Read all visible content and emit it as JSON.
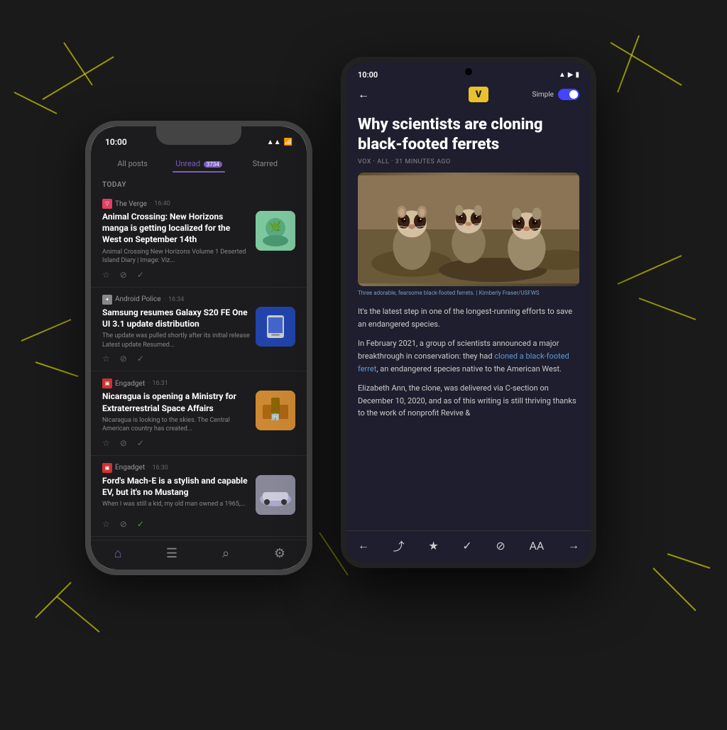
{
  "background": {
    "color": "#1a1a1a"
  },
  "iphone": {
    "status_time": "10:00",
    "tabs": [
      {
        "label": "All posts",
        "active": false
      },
      {
        "label": "Unread",
        "active": true,
        "badge": "3734"
      },
      {
        "label": "Starred",
        "active": false
      }
    ],
    "section_label": "TODAY",
    "feed_items": [
      {
        "source_icon": "▽",
        "source_name": "The Verge",
        "time": "16:40",
        "title": "Animal Crossing: New Horizons manga is getting localized for the West on September 14th",
        "excerpt": "Animal Crossing New Horizons Volume 1 Deserted Island Diary | Image: Viz...",
        "thumb_class": "thumb-ac",
        "has_thumb": true
      },
      {
        "source_icon": "✦",
        "source_name": "Android Police",
        "time": "16:34",
        "title": "Samsung resumes Galaxy S20 FE One UI 3.1 update distribution",
        "excerpt": "The update was pulled shortly after its initial release      Latest update Resumed...",
        "thumb_class": "thumb-samsung",
        "has_thumb": true
      },
      {
        "source_icon": "▣",
        "source_name": "Engadget",
        "time": "16:31",
        "title": "Nicaragua is opening a Ministry for Extraterrestrial Space Affairs",
        "excerpt": "Nicaragua is looking to the skies. The Central American country has created...",
        "thumb_class": "thumb-nicaragua",
        "has_thumb": true
      },
      {
        "source_icon": "▣",
        "source_name": "Engadget",
        "time": "16:30",
        "title": "Ford's Mach-E is a stylish and capable EV, but it's no Mustang",
        "excerpt": "When I was still a kid, my old man owned a 1965,...",
        "thumb_class": "thumb-ford",
        "has_thumb": true
      }
    ],
    "bottom_nav": [
      {
        "icon": "⌂",
        "active": true
      },
      {
        "icon": "☰",
        "active": false
      },
      {
        "icon": "⌕",
        "active": false
      },
      {
        "icon": "⚙",
        "active": false
      }
    ]
  },
  "android": {
    "status_time": "10:00",
    "back_icon": "←",
    "logo_letter": "V",
    "simple_label": "Simple",
    "article": {
      "title": "Why scientists are cloning black-footed ferrets",
      "meta": "VOX · ALL · 31 MINUTES AGO",
      "image_caption": "Three adorable, fearsome black-footed ferrets. | Kimberly Fraser/USFWS",
      "paragraphs": [
        "It's the latest step in one of the longest-running efforts to save an endangered species.",
        "In February 2021, a group of scientists announced a major breakthrough in conservation: they had cloned a black-footed ferret, an endangered species native to the American West.",
        "Elizabeth Ann, the clone, was delivered via C-section on December 10, 2020, and as of this writing is still thriving thanks to the work of nonprofit Revive &"
      ],
      "link_text": "cloned a black-footed ferret"
    },
    "bottom_bar_icons": [
      "←",
      "⤴",
      "★",
      "✓",
      "⊘",
      "AA",
      "→"
    ]
  }
}
